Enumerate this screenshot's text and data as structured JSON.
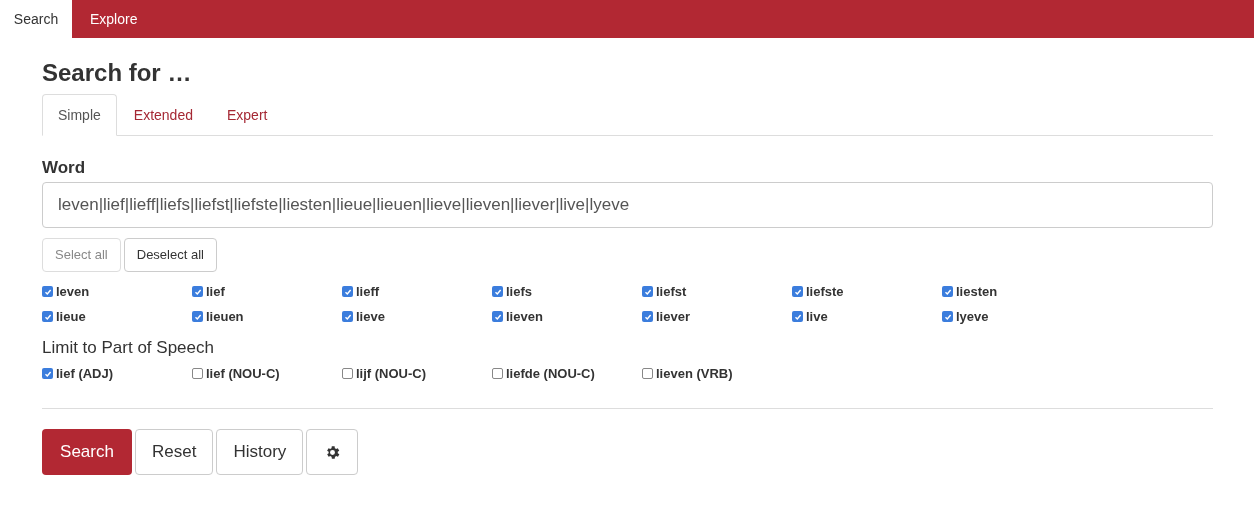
{
  "nav_tabs": [
    {
      "label": "Search",
      "selected": true
    },
    {
      "label": "Explore",
      "selected": false
    }
  ],
  "heading": "Search for …",
  "form_tabs": [
    {
      "label": "Simple",
      "selected": true
    },
    {
      "label": "Extended",
      "selected": false
    },
    {
      "label": "Expert",
      "selected": false
    }
  ],
  "word": {
    "label": "Word",
    "value": "leven|lief|lieff|liefs|liefst|liefste|liesten|lieue|lieuen|lieve|lieven|liever|live|lyeve"
  },
  "select_buttons": [
    {
      "label": "Select all",
      "disabled": true
    },
    {
      "label": "Deselect all",
      "disabled": false
    }
  ],
  "word_options": [
    {
      "label": "leven",
      "checked": true
    },
    {
      "label": "lief",
      "checked": true
    },
    {
      "label": "lieff",
      "checked": true
    },
    {
      "label": "liefs",
      "checked": true
    },
    {
      "label": "liefst",
      "checked": true
    },
    {
      "label": "liefste",
      "checked": true
    },
    {
      "label": "liesten",
      "checked": true
    },
    {
      "label": "lieue",
      "checked": true
    },
    {
      "label": "lieuen",
      "checked": true
    },
    {
      "label": "lieve",
      "checked": true
    },
    {
      "label": "lieven",
      "checked": true
    },
    {
      "label": "liever",
      "checked": true
    },
    {
      "label": "live",
      "checked": true
    },
    {
      "label": "lyeve",
      "checked": true
    }
  ],
  "pos_label": "Limit to Part of Speech",
  "pos_options": [
    {
      "label": "lief (ADJ)",
      "checked": true
    },
    {
      "label": "lief (NOU-C)",
      "checked": false
    },
    {
      "label": "lijf (NOU-C)",
      "checked": false
    },
    {
      "label": "liefde (NOU-C)",
      "checked": false
    },
    {
      "label": "lieven (VRB)",
      "checked": false
    }
  ],
  "actions": [
    {
      "kind": "primary",
      "label": "Search"
    },
    {
      "kind": "default",
      "label": "Reset"
    },
    {
      "kind": "default",
      "label": "History"
    },
    {
      "kind": "settings"
    }
  ]
}
